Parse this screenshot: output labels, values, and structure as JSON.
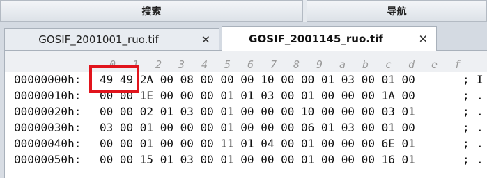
{
  "topbar": {
    "search_label": "搜索",
    "nav_label": "导航"
  },
  "tabs": [
    {
      "title": "GOSIF_2001001_ruo.tif",
      "close": "✕",
      "active": false
    },
    {
      "title": "GOSIF_2001145_ruo.tif",
      "close": "✕",
      "active": true
    }
  ],
  "hex_view": {
    "column_headers": [
      "0",
      "1",
      "2",
      "3",
      "4",
      "5",
      "6",
      "7",
      "8",
      "9",
      "a",
      "b",
      "c",
      "d",
      "e",
      "f"
    ],
    "rows": [
      {
        "address": "00000000h:",
        "bytes": "49 49 2A 00 08 00 00 00 10 00 00 01 03 00 01 00",
        "separator": ";",
        "ascii": "I"
      },
      {
        "address": "00000010h:",
        "bytes": "00 00 1E 00 00 00 01 01 03 00 01 00 00 00 1A 00",
        "separator": ";",
        "ascii": "."
      },
      {
        "address": "00000020h:",
        "bytes": "00 00 02 01 03 00 01 00 00 00 10 00 00 00 03 01",
        "separator": ";",
        "ascii": "."
      },
      {
        "address": "00000030h:",
        "bytes": "03 00 01 00 00 00 01 00 00 00 06 01 03 00 01 00",
        "separator": ";",
        "ascii": "."
      },
      {
        "address": "00000040h:",
        "bytes": "00 00 01 00 00 00 11 01 04 00 01 00 00 00 6E 01",
        "separator": ";",
        "ascii": "."
      },
      {
        "address": "00000050h:",
        "bytes": "00 00 15 01 03 00 01 00 00 00 01 00 00 00 16 01",
        "separator": ";",
        "ascii": "."
      }
    ]
  },
  "highlight_color": "#e1141c"
}
